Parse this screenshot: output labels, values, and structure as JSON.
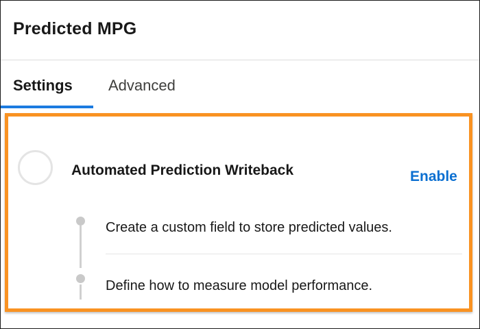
{
  "header": {
    "title": "Predicted MPG"
  },
  "tabs": [
    {
      "label": "Settings",
      "active": true
    },
    {
      "label": "Advanced",
      "active": false
    }
  ],
  "step": {
    "title": "Automated Prediction Writeback",
    "action_label": "Enable",
    "substeps": [
      {
        "label": "Create a custom field to store predicted values."
      },
      {
        "label": "Define how to measure model performance."
      }
    ]
  },
  "colors": {
    "accent": "#1b7be0",
    "link": "#0b6fd1",
    "highlight": "#f99222"
  }
}
